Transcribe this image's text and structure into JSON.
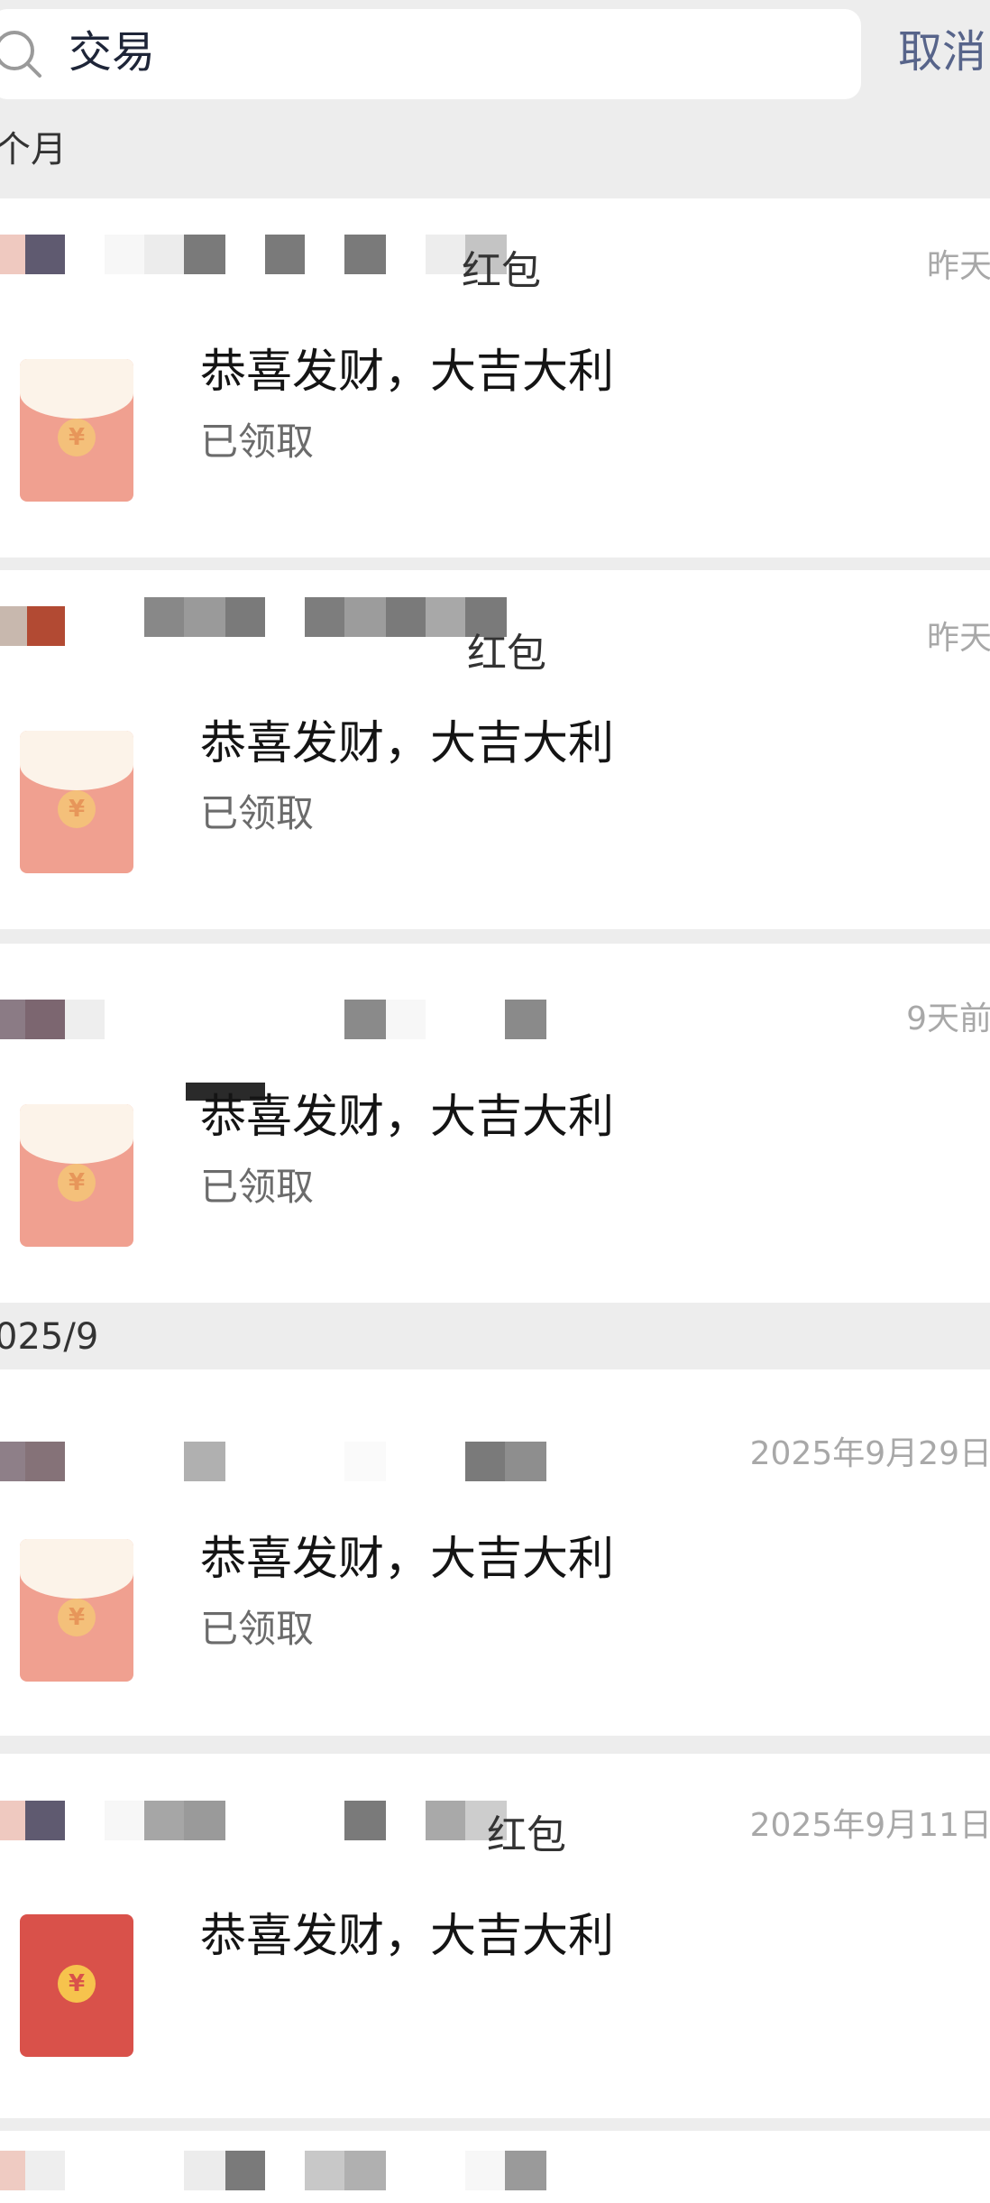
{
  "search": {
    "query": "交易",
    "cancel_label": "取消"
  },
  "sections": {
    "recent": "个月",
    "sep_2025_9": "025/9"
  },
  "cards": [
    {
      "time": "昨天",
      "title": "恭喜发财，大吉大利",
      "status": "已领取",
      "sender_partial": "红包",
      "envelope": "opened"
    },
    {
      "time": "昨天",
      "title": "恭喜发财，大吉大利",
      "status": "已领取",
      "sender_partial": "红包",
      "envelope": "opened"
    },
    {
      "time": "9天前",
      "title": "恭喜发财，大吉大利",
      "status": "已领取",
      "sender_partial": "",
      "envelope": "opened"
    },
    {
      "time": "2025年9月29日",
      "title": "恭喜发财，大吉大利",
      "status": "已领取",
      "sender_partial": "",
      "envelope": "opened"
    },
    {
      "time": "2025年9月11日",
      "title": "恭喜发财，大吉大利",
      "status": "",
      "sender_partial": "红包",
      "envelope": "unopened"
    }
  ],
  "colors": {
    "cancel": "#57648a",
    "envelope_opened": "#f0a090",
    "envelope_unopened": "#d9514a",
    "page_bg": "#ededed"
  }
}
